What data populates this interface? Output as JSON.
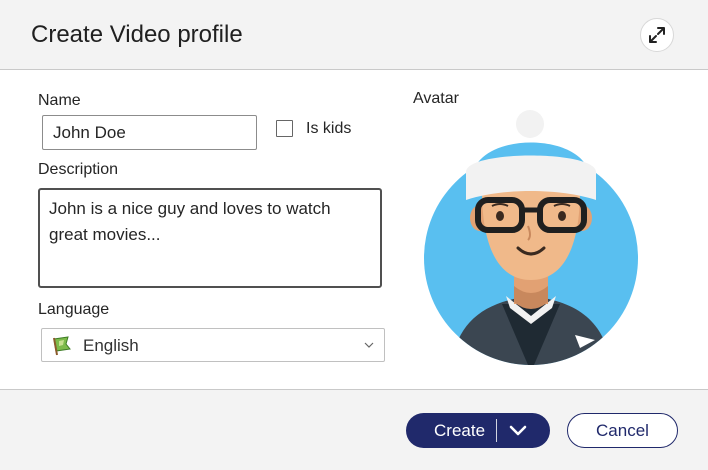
{
  "dialog": {
    "title": "Create Video profile",
    "expand_icon": "expand-diagonal-icon"
  },
  "form": {
    "name_label": "Name",
    "name_value": "John Doe",
    "is_kids_label": "Is kids",
    "is_kids_checked": false,
    "description_label": "Description",
    "description_value": "John is a nice guy and loves to watch great movies...",
    "language_label": "Language",
    "language_value": "English",
    "language_icon": "green-flag-icon"
  },
  "avatar": {
    "label": "Avatar",
    "icon": "man-with-beanie-and-glasses-avatar"
  },
  "footer": {
    "create_label": "Create",
    "cancel_label": "Cancel"
  },
  "colors": {
    "primary": "#20296b",
    "header_bg": "#f3f3f3",
    "avatar_bg": "#59bff0"
  }
}
